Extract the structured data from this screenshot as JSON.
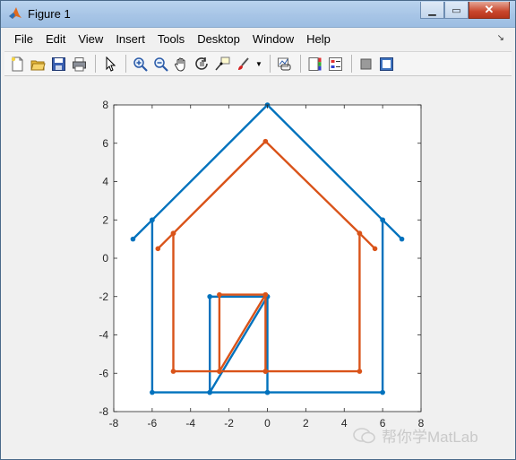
{
  "window": {
    "title": "Figure 1"
  },
  "menu": [
    "File",
    "Edit",
    "View",
    "Insert",
    "Tools",
    "Desktop",
    "Window",
    "Help"
  ],
  "toolbar": {
    "icons": [
      "new-figure-icon",
      "open-file-icon",
      "save-icon",
      "print-icon",
      "pointer-icon",
      "zoom-in-icon",
      "zoom-out-icon",
      "pan-hand-icon",
      "rotate-3d-icon",
      "data-cursor-icon",
      "brush-icon",
      "link-plot-icon",
      "colorbar-icon",
      "legend-icon",
      "hide-plot-tools-icon",
      "show-plot-tools-icon"
    ]
  },
  "watermark": "帮你学MatLab",
  "chart_data": {
    "type": "line",
    "xlim": [
      -8,
      8
    ],
    "ylim": [
      -8,
      8
    ],
    "xticks": [
      "-8",
      "-6",
      "-4",
      "-2",
      "0",
      "2",
      "4",
      "6",
      "8"
    ],
    "yticks": [
      "8",
      "6",
      "4",
      "2",
      "0",
      "-2",
      "-4",
      "-6",
      "-8"
    ],
    "grid": false,
    "series": [
      {
        "color": "#0072bd",
        "x": [
          -7,
          -6,
          0,
          6,
          7,
          6,
          6,
          0,
          0,
          -3,
          -3,
          0,
          0,
          -3,
          -6,
          -6
        ],
        "y": [
          1,
          2,
          8,
          2,
          1,
          2,
          -7,
          -7,
          -2,
          -2,
          -7,
          -7,
          -2,
          -7,
          -7,
          2
        ]
      },
      {
        "color": "#d95319",
        "x": [
          -5.7,
          -4.9,
          -0.1,
          4.8,
          5.6,
          4.8,
          4.8,
          -0.1,
          -0.1,
          -2.5,
          -2.5,
          -0.1,
          -0.1,
          -2.5,
          -4.9,
          -4.9
        ],
        "y": [
          0.5,
          1.3,
          6.1,
          1.3,
          0.5,
          1.3,
          -5.9,
          -5.9,
          -1.9,
          -1.9,
          -5.9,
          -5.9,
          -1.9,
          -5.9,
          -5.9,
          1.3
        ]
      }
    ]
  }
}
